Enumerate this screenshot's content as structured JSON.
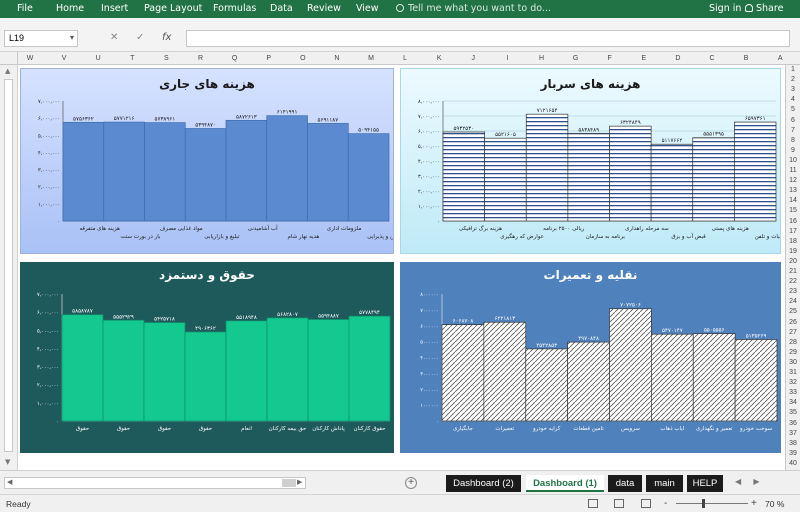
{
  "ribbon": {
    "tabs": [
      "File",
      "Home",
      "Insert",
      "Page Layout",
      "Formulas",
      "Data",
      "Review",
      "View"
    ],
    "tell_me": "Tell me what you want to do...",
    "sign_in": "Sign in",
    "share": "Share"
  },
  "formula_bar": {
    "name_box": "L19",
    "fx": "fx",
    "formula": ""
  },
  "columns": [
    "W",
    "V",
    "U",
    "T",
    "S",
    "R",
    "Q",
    "P",
    "O",
    "N",
    "M",
    "L",
    "K",
    "J",
    "I",
    "H",
    "G",
    "F",
    "E",
    "D",
    "C",
    "B",
    "A"
  ],
  "rows": [
    "1",
    "2",
    "3",
    "4",
    "5",
    "6",
    "7",
    "8",
    "9",
    "10",
    "11",
    "12",
    "13",
    "14",
    "15",
    "16",
    "17",
    "18",
    "19",
    "20",
    "21",
    "22",
    "23",
    "24",
    "25",
    "26",
    "27",
    "28",
    "29",
    "30",
    "31",
    "32",
    "33",
    "34",
    "35",
    "36",
    "37",
    "38",
    "39",
    "40"
  ],
  "sheet_tabs": [
    "Dashboard (2)",
    "Dashboard (1)",
    "data",
    "main",
    "HELP"
  ],
  "active_tab": "Dashboard (1)",
  "status": {
    "ready": "Ready",
    "zoom": "70 %",
    "minus": "-",
    "plus": "+"
  },
  "colors": {
    "excel_green": "#217346"
  },
  "chart_data": [
    {
      "id": "current",
      "type": "bar",
      "title": "هزینه های جاری",
      "bg_top": "#d6e2ff",
      "bg_bottom": "#a9c1f6",
      "bar_color": "#5b8ad0",
      "bar_fill": "solid",
      "ylim": [
        0,
        7000000
      ],
      "yticks": [
        "۷,۰۰۰,۰۰۰",
        "۶,۰۰۰,۰۰۰",
        "۵,۰۰۰,۰۰۰",
        "۴,۰۰۰,۰۰۰",
        "۳,۰۰۰,۰۰۰",
        "۲,۰۰۰,۰۰۰",
        "۱,۰۰۰,۰۰۰",
        "۰"
      ],
      "values": [
        5756362,
        5771216,
        5738961,
        5394870,
        5872613,
        6141991,
        5691187,
        5094155
      ],
      "value_labels": [
        "۵۷۵۶۳۶۲",
        "۵۷۷۱۲۱۶",
        "۵۷۳۸۹۶۱",
        "۵۳۹۴۸۷۰",
        "۵۸۷۲۶۱۳",
        "۶۱۴۱۹۹۱",
        "۵۶۹۱۱۸۷",
        "۵۰۹۴۱۵۵"
      ],
      "categories": [
        "هزینه های متفرقه",
        "بار در بورت ستت",
        "مواد غذایی مصرف",
        "تبلیغ و بازاریابی",
        "آب آشامیدنی",
        "هدیه نهار شام",
        "ملزومات اداری",
        "جشن و پذیرایی"
      ]
    },
    {
      "id": "server",
      "type": "bar",
      "title": "هزینه های سربار",
      "bg_top": "#ecfaff",
      "bg_bottom": "#bfeaf7",
      "bar_color": "#2f4f8f",
      "bar_fill": "hlines",
      "ylim": [
        0,
        8000000
      ],
      "yticks": [
        "۸,۰۰۰,۰۰۰",
        "۷,۰۰۰,۰۰۰",
        "۶,۰۰۰,۰۰۰",
        "۵,۰۰۰,۰۰۰",
        "۴,۰۰۰,۰۰۰",
        "۳,۰۰۰,۰۰۰",
        "۲,۰۰۰,۰۰۰",
        "۱,۰۰۰,۰۰۰",
        "۰"
      ],
      "values": [
        5932530,
        5521605,
        7121654,
        5838489,
        6324849,
        5117662,
        5551395,
        6597361
      ],
      "value_labels": [
        "۵۹۳۲۵۳۰",
        "۵۵۲۱۶۰۵",
        "۷۱۲۱۶۵۴",
        "۵۸۳۸۴۸۹",
        "۶۳۲۴۸۴۹",
        "۵۱۱۷۶۶۲",
        "۵۵۵۱۳۹۵",
        "۶۵۹۷۳۶۱"
      ],
      "categories": [
        "هزینه برگ ترافیکی",
        "عوارض که رهگیری",
        "ریالی ۲۵۰۰ برنامه",
        "برنامه به سازمان",
        "سه مرحله راهداری",
        "قبض آب و برق",
        "هزینه های پستی",
        "مکاتبات و تلفن"
      ]
    },
    {
      "id": "salary",
      "type": "bar",
      "title": "حقوق و دستمزد",
      "bg_top": "#1e5a5c",
      "bg_bottom": "#1e5a5c",
      "bar_color": "#13c98f",
      "bar_fill": "solid",
      "ylim": [
        0,
        7000000
      ],
      "yticks": [
        "۷,۰۰۰,۰۰۰",
        "۶,۰۰۰,۰۰۰",
        "۵,۰۰۰,۰۰۰",
        "۴,۰۰۰,۰۰۰",
        "۳,۰۰۰,۰۰۰",
        "۲,۰۰۰,۰۰۰",
        "۱,۰۰۰,۰۰۰",
        "۰"
      ],
      "values": [
        5858787,
        5552929,
        5425718,
        4906362,
        5518948,
        5682807,
        5594887,
        5778494
      ],
      "value_labels": [
        "۵۸۵۸۷۸۷",
        "۵۵۵۲۹۲۹",
        "۵۴۲۵۷۱۸",
        "۴۹۰۶۳۶۲",
        "۵۵۱۸۹۴۸",
        "۵۶۸۲۸۰۷",
        "۵۵۹۴۸۸۷",
        "۵۷۷۸۴۹۴"
      ],
      "categories": [
        "حقوق",
        "حقوق",
        "حقوق",
        "حقوق",
        "انعام",
        "حق بیمه کارکنان",
        "پاداش کارکنان",
        "حقوق کارکنان"
      ]
    },
    {
      "id": "transport",
      "type": "bar",
      "title": "نقلیه و تعمیرات",
      "bg_top": "#4f81bd",
      "bg_bottom": "#4f81bd",
      "bar_color": "#ffffff",
      "bar_fill": "diag",
      "ylim": [
        0,
        8000000
      ],
      "yticks": [
        "۸۰۰۰۰۰۰",
        "۷۰۰۰۰۰۰",
        "۶۰۰۰۰۰۰",
        "۵۰۰۰۰۰۰",
        "۴۰۰۰۰۰۰",
        "۳۰۰۰۰۰۰",
        "۲۰۰۰۰۰۰",
        "۱۰۰۰۰۰۰",
        "۰"
      ],
      "values": [
        6068708,
        6221813,
        4542853,
        4970848,
        7072506,
        5470147,
        5505556,
        5135269
      ],
      "value_labels": [
        "۶۰۶۸۷۰۸",
        "۶۲۲۱۸۱۳",
        "۴۵۴۲۸۵۳",
        "۴۹۷۰۸۴۸",
        "۷۰۷۲۵۰۶",
        "۵۴۷۰۱۴۷",
        "۵۵۰۵۵۵۶",
        "۵۱۳۵۲۶۹"
      ],
      "categories": [
        "جابگیاری",
        "تعمیرات",
        "کرایه خودرو",
        "تامین قطعات",
        "سرویس",
        "ایاب ذهاب",
        "تعمیر و نگهداری",
        "سوخت خودرو"
      ]
    }
  ]
}
